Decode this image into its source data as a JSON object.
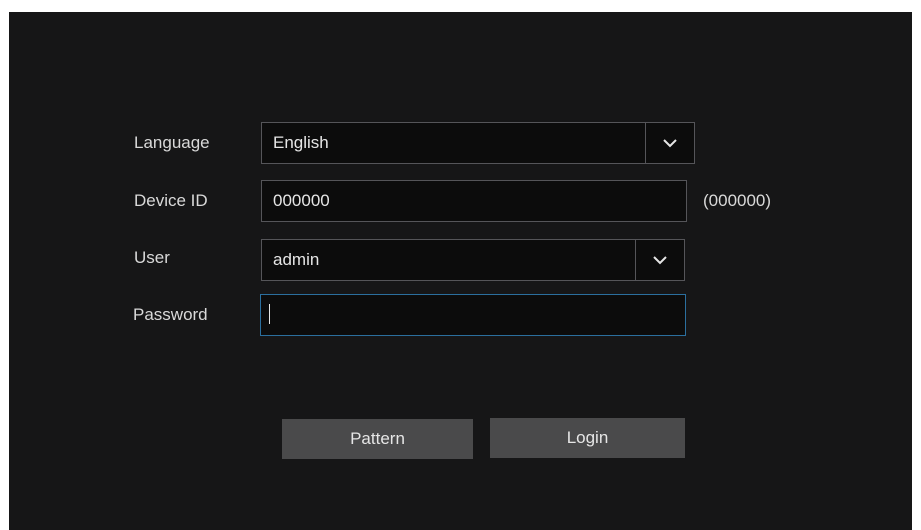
{
  "login_form": {
    "language": {
      "label": "Language",
      "value": "English",
      "icon": "chevron-down-icon"
    },
    "device_id": {
      "label": "Device ID",
      "value": "000000",
      "hint": "(000000)"
    },
    "user": {
      "label": "User",
      "value": "admin",
      "icon": "chevron-down-icon"
    },
    "password": {
      "label": "Password",
      "value": ""
    }
  },
  "buttons": {
    "pattern_label": "Pattern",
    "login_label": "Login"
  },
  "colors": {
    "background": "#161617",
    "field_background": "#0c0c0c",
    "field_border": "#555559",
    "focus_border": "#2b6f9e",
    "button": "#4a4a4b",
    "text": "#e6e6e6"
  }
}
